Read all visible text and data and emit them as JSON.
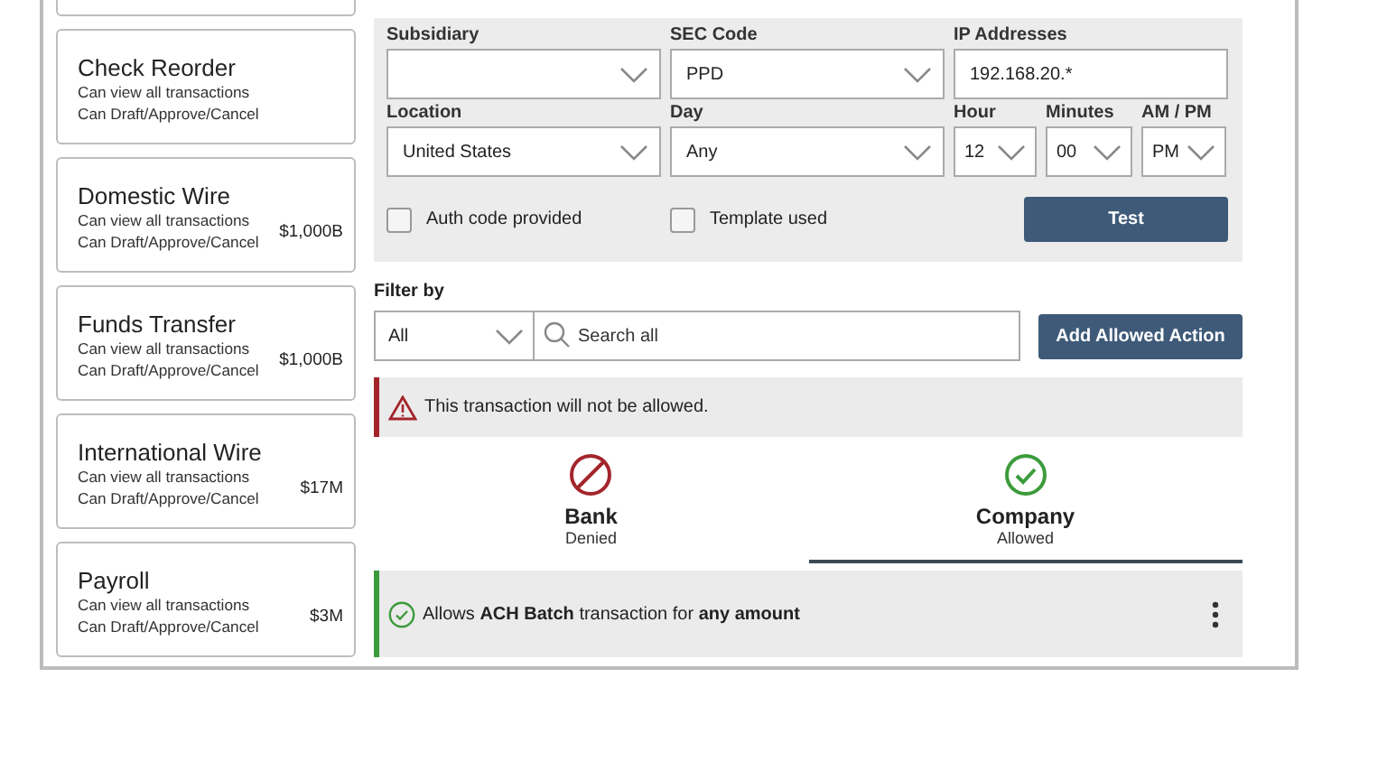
{
  "sidebar": {
    "items": [
      {
        "kind": "cut_off"
      },
      {
        "kind": "full",
        "title": "Check Reorder",
        "lines": [
          "Can view all transactions",
          "Can Draft/Approve/Cancel"
        ]
      },
      {
        "kind": "full",
        "title": "Domestic Wire",
        "lines": [
          "Can view all transactions",
          "Can Draft/Approve/Cancel"
        ],
        "amount": "$1,000B"
      },
      {
        "kind": "full",
        "title": "Funds Transfer",
        "lines": [
          "Can view all transactions",
          "Can Draft/Approve/Cancel"
        ],
        "amount": "$1,000B"
      },
      {
        "kind": "full",
        "title": "International Wire",
        "lines": [
          "Can view all transactions",
          "Can Draft/Approve/Cancel"
        ],
        "amount": "$17M"
      },
      {
        "kind": "full",
        "title": "Payroll",
        "lines": [
          "Can view all transactions",
          "Can Draft/Approve/Cancel"
        ],
        "amount": "$3M"
      }
    ]
  },
  "form": {
    "row1": [
      {
        "label": "Subsidiary",
        "kind": "select"
      },
      {
        "label": "SEC Code",
        "kind": "select",
        "value": "PPD"
      },
      {
        "label": "IP Addresses",
        "kind": "text",
        "value": "192.168.20.*"
      }
    ],
    "location": {
      "label": "Location",
      "value": "United States"
    },
    "day": {
      "label": "Day",
      "value": "Any"
    },
    "time": [
      {
        "label": "Hour",
        "value": "12"
      },
      {
        "label": "Minutes",
        "value": "00"
      },
      {
        "label": "AM / PM",
        "value": "PM"
      }
    ],
    "checkboxes": [
      {
        "label": "Auth code provided",
        "checked": false
      },
      {
        "label": "Template used",
        "checked": false
      }
    ],
    "test_button": "Test"
  },
  "filter": {
    "label": "Filter by",
    "select": "All",
    "search_placeholder": "Search all",
    "add_button": "Add Allowed Action"
  },
  "alert": {
    "text": "This transaction will not be allowed."
  },
  "tabs": [
    {
      "title": "Bank",
      "status_text": "Denied",
      "kind": "denied",
      "selected": false
    },
    {
      "title": "Company",
      "status_text": "Allowed",
      "kind": "allowed",
      "selected": true
    }
  ],
  "rules": [
    {
      "text": "Allows **ACH Batch** transaction for **any amount**"
    }
  ]
}
